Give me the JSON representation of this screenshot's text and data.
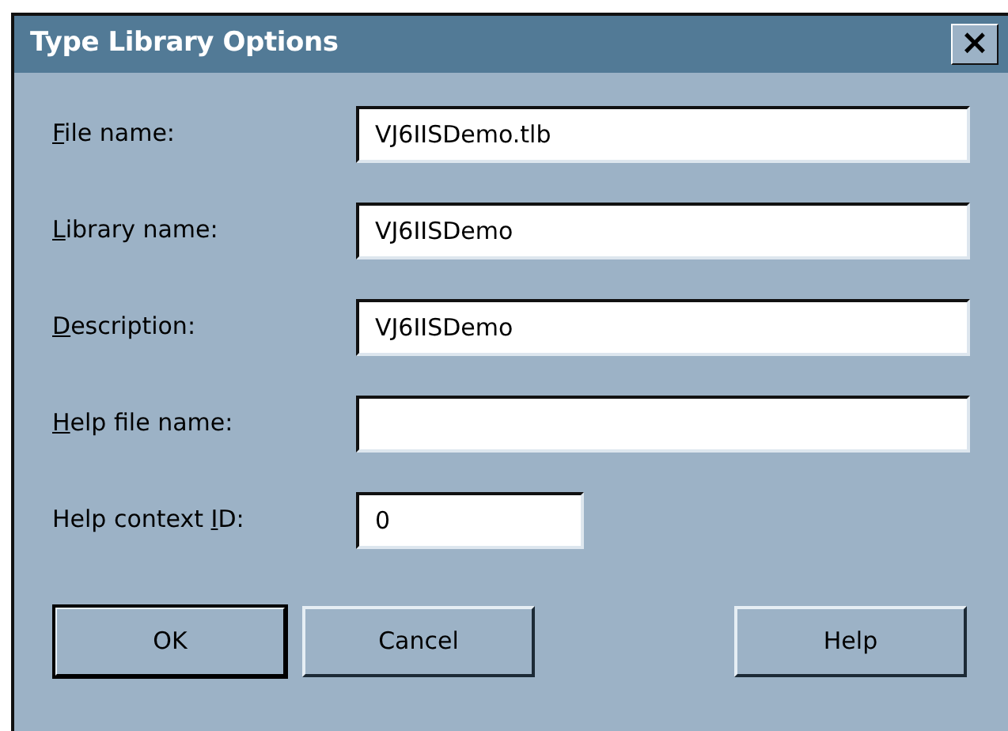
{
  "window": {
    "title": "Type Library Options",
    "close": "×"
  },
  "fields": [
    {
      "label": {
        "key": "F",
        "after": "ile name:"
      },
      "value": "VJ6IISDemo.tlb",
      "kind": "wide"
    },
    {
      "label": {
        "key": "L",
        "after": "ibrary name:"
      },
      "value": "VJ6IISDemo",
      "kind": "wide"
    },
    {
      "label": {
        "key": "D",
        "after": "escription:"
      },
      "value": "VJ6IISDemo",
      "kind": "wide"
    },
    {
      "label": {
        "key": "H",
        "after": "elp file name:"
      },
      "kind": "wide"
    },
    {
      "label": {
        "before": "Help context ",
        "key": "I",
        "after": "D:"
      },
      "value": "0",
      "kind": "short"
    }
  ],
  "buttons": [
    {
      "label": "OK",
      "default": true
    },
    {
      "label": "Cancel",
      "default": false
    },
    {
      "label": "Help",
      "default": false
    }
  ]
}
